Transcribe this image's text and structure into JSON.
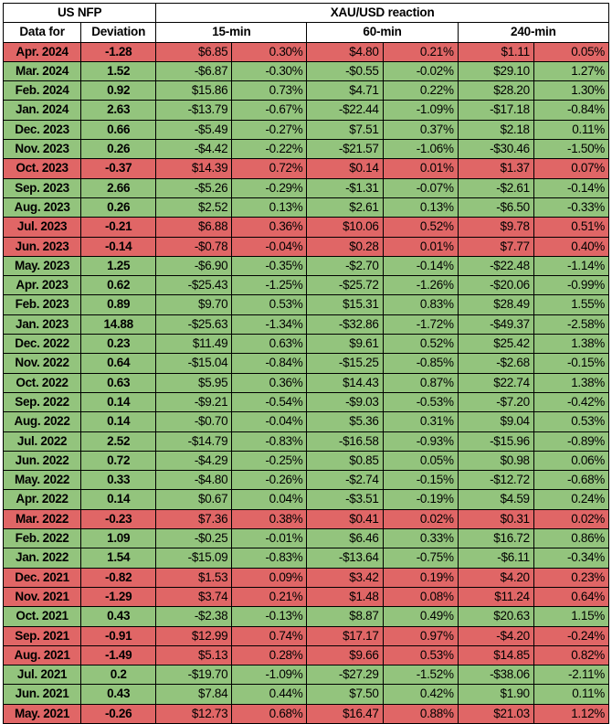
{
  "table": {
    "title_left": "US NFP",
    "title_right": "XAU/USD reaction",
    "columns": {
      "month": "Data for",
      "deviation": "Deviation",
      "groups": [
        "15-min",
        "60-min",
        "240-min"
      ]
    },
    "colors": {
      "bullish_fill": "#93c47d",
      "bearish_fill": "#e06666",
      "grid": "#000000",
      "header_fill": "#ffffff"
    },
    "rows": [
      {
        "month": "Apr. 2024",
        "deviation": "-1.28",
        "tone": "bear",
        "m15": "$6.85",
        "p15": "0.30%",
        "m60": "$4.80",
        "p60": "0.21%",
        "m240": "$1.11",
        "p240": "0.05%"
      },
      {
        "month": "Mar. 2024",
        "deviation": "1.52",
        "tone": "bull",
        "m15": "-$6.87",
        "p15": "-0.30%",
        "m60": "-$0.55",
        "p60": "-0.02%",
        "m240": "$29.10",
        "p240": "1.27%"
      },
      {
        "month": "Feb. 2024",
        "deviation": "0.92",
        "tone": "bull",
        "m15": "$15.86",
        "p15": "0.73%",
        "m60": "$4.71",
        "p60": "0.22%",
        "m240": "$28.20",
        "p240": "1.30%"
      },
      {
        "month": "Jan. 2024",
        "deviation": "2.63",
        "tone": "bull",
        "m15": "-$13.79",
        "p15": "-0.67%",
        "m60": "-$22.44",
        "p60": "-1.09%",
        "m240": "-$17.18",
        "p240": "-0.84%"
      },
      {
        "month": "Dec. 2023",
        "deviation": "0.66",
        "tone": "bull",
        "m15": "-$5.49",
        "p15": "-0.27%",
        "m60": "$7.51",
        "p60": "0.37%",
        "m240": "$2.18",
        "p240": "0.11%"
      },
      {
        "month": "Nov. 2023",
        "deviation": "0.26",
        "tone": "bull",
        "m15": "-$4.42",
        "p15": "-0.22%",
        "m60": "-$21.57",
        "p60": "-1.06%",
        "m240": "-$30.46",
        "p240": "-1.50%"
      },
      {
        "month": "Oct. 2023",
        "deviation": "-0.37",
        "tone": "bear",
        "m15": "$14.39",
        "p15": "0.72%",
        "m60": "$0.14",
        "p60": "0.01%",
        "m240": "$1.37",
        "p240": "0.07%"
      },
      {
        "month": "Sep. 2023",
        "deviation": "2.66",
        "tone": "bull",
        "m15": "-$5.26",
        "p15": "-0.29%",
        "m60": "-$1.31",
        "p60": "-0.07%",
        "m240": "-$2.61",
        "p240": "-0.14%"
      },
      {
        "month": "Aug. 2023",
        "deviation": "0.26",
        "tone": "bull",
        "m15": "$2.52",
        "p15": "0.13%",
        "m60": "$2.61",
        "p60": "0.13%",
        "m240": "-$6.50",
        "p240": "-0.33%"
      },
      {
        "month": "Jul. 2023",
        "deviation": "-0.21",
        "tone": "bear",
        "m15": "$6.88",
        "p15": "0.36%",
        "m60": "$10.06",
        "p60": "0.52%",
        "m240": "$9.78",
        "p240": "0.51%"
      },
      {
        "month": "Jun. 2023",
        "deviation": "-0.14",
        "tone": "bear",
        "m15": "-$0.78",
        "p15": "-0.04%",
        "m60": "$0.28",
        "p60": "0.01%",
        "m240": "$7.77",
        "p240": "0.40%"
      },
      {
        "month": "May. 2023",
        "deviation": "1.25",
        "tone": "bull",
        "m15": "-$6.90",
        "p15": "-0.35%",
        "m60": "-$2.70",
        "p60": "-0.14%",
        "m240": "-$22.48",
        "p240": "-1.14%"
      },
      {
        "month": "Apr. 2023",
        "deviation": "0.62",
        "tone": "bull",
        "m15": "-$25.43",
        "p15": "-1.25%",
        "m60": "-$25.72",
        "p60": "-1.26%",
        "m240": "-$20.06",
        "p240": "-0.99%"
      },
      {
        "month": "Feb. 2023",
        "deviation": "0.89",
        "tone": "bull",
        "m15": "$9.70",
        "p15": "0.53%",
        "m60": "$15.31",
        "p60": "0.83%",
        "m240": "$28.49",
        "p240": "1.55%"
      },
      {
        "month": "Jan. 2023",
        "deviation": "14.88",
        "tone": "bull",
        "m15": "-$25.63",
        "p15": "-1.34%",
        "m60": "-$32.86",
        "p60": "-1.72%",
        "m240": "-$49.37",
        "p240": "-2.58%"
      },
      {
        "month": "Dec. 2022",
        "deviation": "0.23",
        "tone": "bull",
        "m15": "$11.49",
        "p15": "0.63%",
        "m60": "$9.61",
        "p60": "0.52%",
        "m240": "$25.42",
        "p240": "1.38%"
      },
      {
        "month": "Nov. 2022",
        "deviation": "0.64",
        "tone": "bull",
        "m15": "-$15.04",
        "p15": "-0.84%",
        "m60": "-$15.25",
        "p60": "-0.85%",
        "m240": "-$2.68",
        "p240": "-0.15%"
      },
      {
        "month": "Oct. 2022",
        "deviation": "0.63",
        "tone": "bull",
        "m15": "$5.95",
        "p15": "0.36%",
        "m60": "$14.43",
        "p60": "0.87%",
        "m240": "$22.74",
        "p240": "1.38%"
      },
      {
        "month": "Sep. 2022",
        "deviation": "0.14",
        "tone": "bull",
        "m15": "-$9.21",
        "p15": "-0.54%",
        "m60": "-$9.03",
        "p60": "-0.53%",
        "m240": "-$7.20",
        "p240": "-0.42%"
      },
      {
        "month": "Aug. 2022",
        "deviation": "0.14",
        "tone": "bull",
        "m15": "-$0.70",
        "p15": "-0.04%",
        "m60": "$5.36",
        "p60": "0.31%",
        "m240": "$9.04",
        "p240": "0.53%"
      },
      {
        "month": "Jul. 2022",
        "deviation": "2.52",
        "tone": "bull",
        "m15": "-$14.79",
        "p15": "-0.83%",
        "m60": "-$16.58",
        "p60": "-0.93%",
        "m240": "-$15.96",
        "p240": "-0.89%"
      },
      {
        "month": "Jun. 2022",
        "deviation": "0.72",
        "tone": "bull",
        "m15": "-$4.29",
        "p15": "-0.25%",
        "m60": "$0.85",
        "p60": "0.05%",
        "m240": "$0.98",
        "p240": "0.06%"
      },
      {
        "month": "May. 2022",
        "deviation": "0.33",
        "tone": "bull",
        "m15": "-$4.80",
        "p15": "-0.26%",
        "m60": "-$2.74",
        "p60": "-0.15%",
        "m240": "-$12.72",
        "p240": "-0.68%"
      },
      {
        "month": "Apr. 2022",
        "deviation": "0.14",
        "tone": "bull",
        "m15": "$0.67",
        "p15": "0.04%",
        "m60": "-$3.51",
        "p60": "-0.19%",
        "m240": "$4.59",
        "p240": "0.24%"
      },
      {
        "month": "Mar. 2022",
        "deviation": "-0.23",
        "tone": "bear",
        "m15": "$7.36",
        "p15": "0.38%",
        "m60": "$0.41",
        "p60": "0.02%",
        "m240": "$0.31",
        "p240": "0.02%"
      },
      {
        "month": "Feb. 2022",
        "deviation": "1.09",
        "tone": "bull",
        "m15": "-$0.25",
        "p15": "-0.01%",
        "m60": "$6.46",
        "p60": "0.33%",
        "m240": "$16.72",
        "p240": "0.86%"
      },
      {
        "month": "Jan. 2022",
        "deviation": "1.54",
        "tone": "bull",
        "m15": "-$15.09",
        "p15": "-0.83%",
        "m60": "-$13.64",
        "p60": "-0.75%",
        "m240": "-$6.11",
        "p240": "-0.34%"
      },
      {
        "month": "Dec. 2021",
        "deviation": "-0.82",
        "tone": "bear",
        "m15": "$1.53",
        "p15": "0.09%",
        "m60": "$3.42",
        "p60": "0.19%",
        "m240": "$4.20",
        "p240": "0.23%"
      },
      {
        "month": "Nov. 2021",
        "deviation": "-1.29",
        "tone": "bear",
        "m15": "$3.74",
        "p15": "0.21%",
        "m60": "$1.48",
        "p60": "0.08%",
        "m240": "$11.24",
        "p240": "0.64%"
      },
      {
        "month": "Oct. 2021",
        "deviation": "0.43",
        "tone": "bull",
        "m15": "-$2.38",
        "p15": "-0.13%",
        "m60": "$8.87",
        "p60": "0.49%",
        "m240": "$20.63",
        "p240": "1.15%"
      },
      {
        "month": "Sep. 2021",
        "deviation": "-0.91",
        "tone": "bear",
        "m15": "$12.99",
        "p15": "0.74%",
        "m60": "$17.17",
        "p60": "0.97%",
        "m240": "-$4.20",
        "p240": "-0.24%"
      },
      {
        "month": "Aug. 2021",
        "deviation": "-1.49",
        "tone": "bear",
        "m15": "$5.13",
        "p15": "0.28%",
        "m60": "$9.66",
        "p60": "0.53%",
        "m240": "$14.85",
        "p240": "0.82%"
      },
      {
        "month": "Jul. 2021",
        "deviation": "0.2",
        "tone": "bull",
        "m15": "-$19.70",
        "p15": "-1.09%",
        "m60": "-$27.29",
        "p60": "-1.52%",
        "m240": "-$38.06",
        "p240": "-2.11%"
      },
      {
        "month": "Jun. 2021",
        "deviation": "0.43",
        "tone": "bull",
        "m15": "$7.84",
        "p15": "0.44%",
        "m60": "$7.50",
        "p60": "0.42%",
        "m240": "$1.90",
        "p240": "0.11%"
      },
      {
        "month": "May. 2021",
        "deviation": "-0.26",
        "tone": "bear",
        "m15": "$12.73",
        "p15": "0.68%",
        "m60": "$16.47",
        "p60": "0.88%",
        "m240": "$21.03",
        "p240": "1.12%"
      }
    ]
  }
}
